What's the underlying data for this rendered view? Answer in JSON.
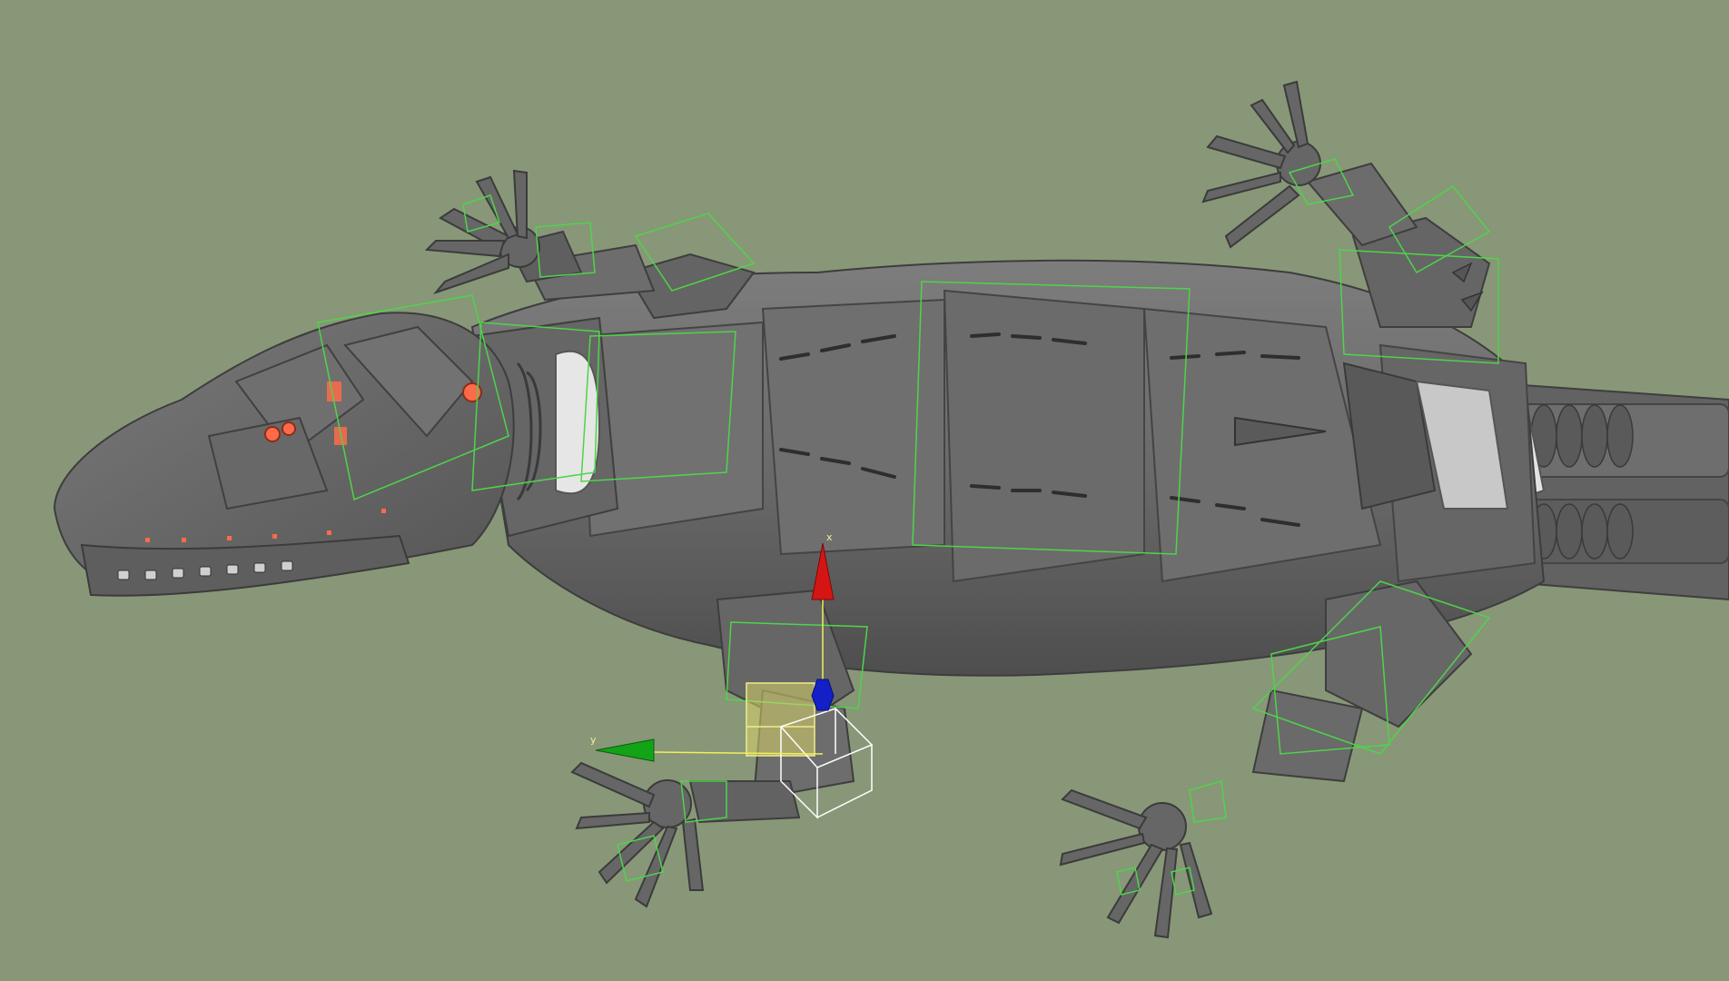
{
  "viewport": {
    "background_color": "#889778",
    "model_color": "#6c6c6c",
    "model_shadow_color": "#4b4b4b",
    "model_highlight_color": "#8a8a8a",
    "selection_box_color": "#4fd44a",
    "selected_bone_fill": "#d8d36a",
    "gizmo_bounding_box_color": "#ffffff",
    "accent_eye_color": "#ff6b4a"
  },
  "gizmo": {
    "type": "move-gizmo",
    "x_axis_label": "x",
    "y_axis_label": "y",
    "x_axis_color": "#d51414",
    "y_axis_color": "#12a316",
    "z_axis_color": "#1320c8",
    "axis_line_color": "#f2ef5a"
  },
  "model": {
    "icon": "lizard-rig-icon"
  }
}
